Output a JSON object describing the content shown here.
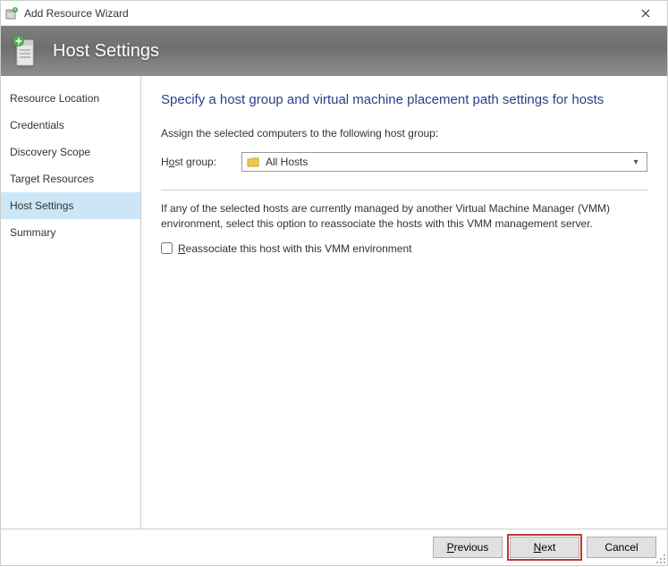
{
  "window": {
    "title": "Add Resource Wizard"
  },
  "header": {
    "title": "Host Settings"
  },
  "sidebar": {
    "items": [
      {
        "label": "Resource Location",
        "active": false
      },
      {
        "label": "Credentials",
        "active": false
      },
      {
        "label": "Discovery Scope",
        "active": false
      },
      {
        "label": "Target Resources",
        "active": false
      },
      {
        "label": "Host Settings",
        "active": true
      },
      {
        "label": "Summary",
        "active": false
      }
    ]
  },
  "main": {
    "heading": "Specify a host group and virtual machine placement path settings for hosts",
    "instruction": "Assign the selected computers to the following host group:",
    "host_group_label_pre": "H",
    "host_group_label_u": "o",
    "host_group_label_post": "st group:",
    "host_group_value": "All Hosts",
    "note": "If any of the selected hosts are currently managed by another Virtual Machine Manager (VMM) environment, select this option to reassociate the hosts with this VMM management server.",
    "checkbox_label_u": "R",
    "checkbox_label_post": "eassociate this host with this VMM environment"
  },
  "footer": {
    "previous_u": "P",
    "previous_post": "revious",
    "next_u": "N",
    "next_post": "ext",
    "cancel": "Cancel"
  }
}
